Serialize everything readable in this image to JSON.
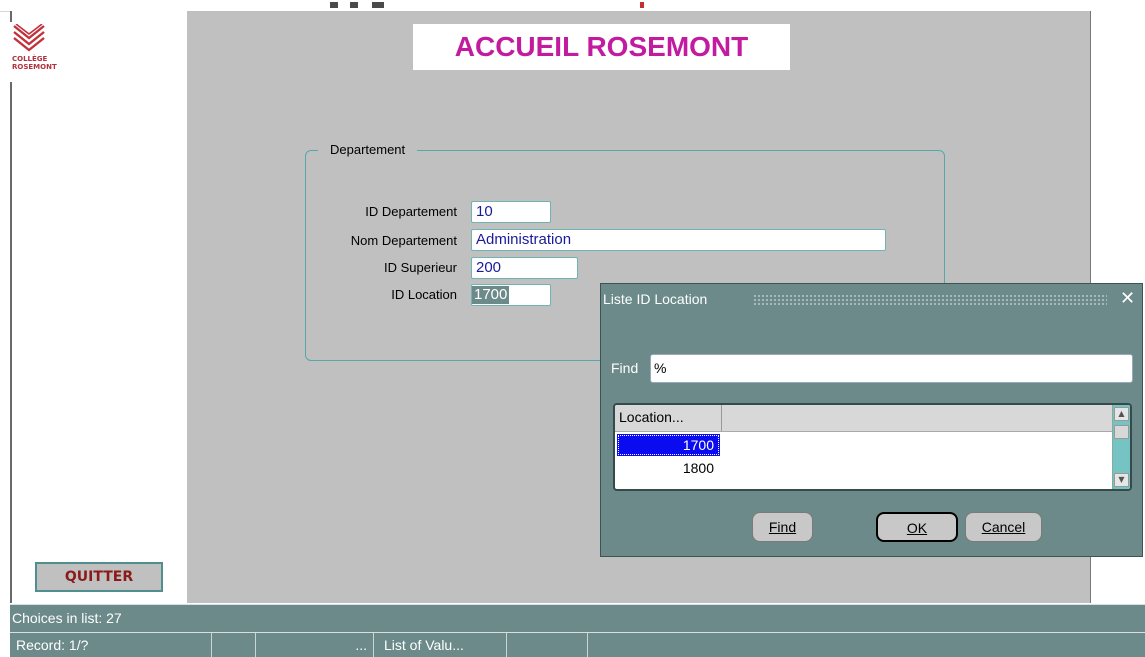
{
  "app": {
    "title": "ACCUEIL ROSEMONT",
    "logo_text_line1": "COLLÈGE",
    "logo_text_line2": "ROSEMONT",
    "quit_label": "QUITTER"
  },
  "form": {
    "frame_title": "Departement",
    "fields": [
      {
        "label": "ID Departement",
        "value": "10"
      },
      {
        "label": "Nom Departement",
        "value": "Administration"
      },
      {
        "label": "ID Superieur",
        "value": "200"
      },
      {
        "label": "ID Location",
        "value": "1700"
      }
    ]
  },
  "dialog": {
    "title": "Liste ID Location",
    "close_icon": "close-icon",
    "find_label": "Find",
    "find_value": "%",
    "column_header": "Location...",
    "rows": [
      "1700",
      "1800"
    ],
    "selected_row": "1700",
    "buttons": {
      "find": "Find",
      "ok": "OK",
      "cancel": "Cancel"
    }
  },
  "status": {
    "message": "Choices in list: 27",
    "record": "Record: 1/?",
    "ellipsis": "...",
    "mode": "List of Valu..."
  },
  "colors": {
    "title_magenta": "#c21ba0",
    "canvas_gray": "#c0c0c0",
    "dialog_teal": "#6b8a89",
    "selection_blue": "#0b0bf0"
  }
}
